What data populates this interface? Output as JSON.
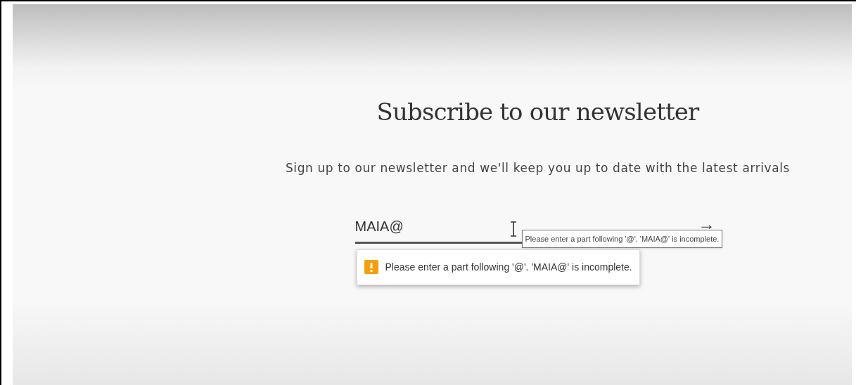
{
  "heading": "Subscribe to our newsletter",
  "subheading": "Sign up to our newsletter and we'll keep you up to date with the latest arrivals",
  "email_field": {
    "value": "MAIA@",
    "invalid": true
  },
  "submit_button": {
    "label": "→"
  },
  "validation_bubble": {
    "message": "Please enter a part following '@'. 'MAIA@' is incomplete."
  },
  "tooltip": {
    "text": "Please enter a part following '@'. 'MAIA@' is incomplete."
  }
}
